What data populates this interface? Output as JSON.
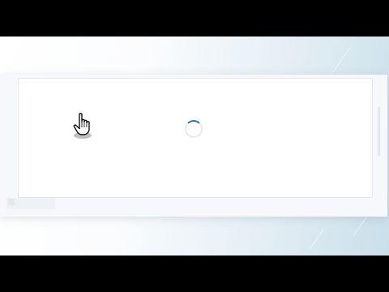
{
  "colors": {
    "letterbox": "#000000",
    "panel": "#ffffff",
    "spinner_track": "#e7eaf0",
    "spinner_accent": "#2a6fb8"
  },
  "icons": {
    "cursor": "hand-pointer-icon",
    "loading": "loading-spinner-icon"
  },
  "state": {
    "loading": true
  }
}
